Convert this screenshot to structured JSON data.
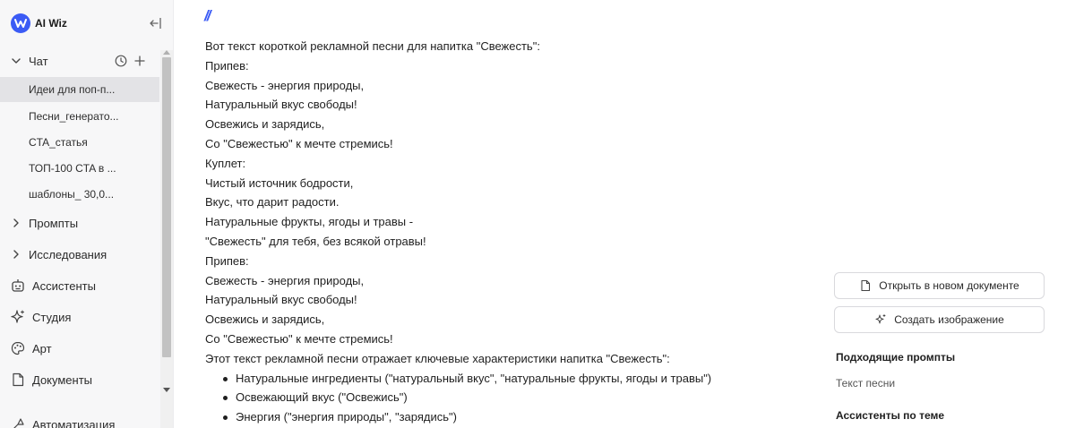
{
  "app": {
    "name": "AI Wiz",
    "accent_color": "#3b5bf5"
  },
  "sidebar": {
    "chat_section": {
      "label": "Чат"
    },
    "chats": [
      {
        "label": "Идеи для поп-п..."
      },
      {
        "label": "Песни_генерато..."
      },
      {
        "label": "CTA_статья"
      },
      {
        "label": "ТОП-100 CTA в ..."
      },
      {
        "label": "шаблоны_ 30,0..."
      }
    ],
    "collapsed_sections": [
      {
        "label": "Промпты"
      },
      {
        "label": "Исследования"
      }
    ],
    "nav": [
      {
        "label": "Ассистенты",
        "icon": "robot-icon"
      },
      {
        "label": "Студия",
        "icon": "sparkle-icon"
      },
      {
        "label": "Арт",
        "icon": "palette-icon"
      },
      {
        "label": "Документы",
        "icon": "document-icon"
      },
      {
        "label": "Автоматизация",
        "icon": "automation-icon"
      }
    ]
  },
  "message": {
    "lines": [
      "Вот текст короткой рекламной песни для напитка \"Свежесть\":",
      "Припев:",
      "Свежесть - энергия природы,",
      "Натуральный вкус свободы!",
      "Освежись и зарядись,",
      "Со \"Свежестью\" к мечте стремись!",
      "Куплет:",
      "Чистый источник бодрости,",
      "Вкус, что дарит радости.",
      "Натуральные фрукты, ягоды и травы -",
      "\"Свежесть\" для тебя, без всякой отравы!",
      "Припев:",
      "Свежесть - энергия природы,",
      "Натуральный вкус свободы!",
      "Освежись и зарядись,",
      "Со \"Свежестью\" к мечте стремись!",
      "Этот текст рекламной песни отражает ключевые характеристики напитка \"Свежесть\":"
    ],
    "bullets": [
      "Натуральные ингредиенты (\"натуральный вкус\", \"натуральные фрукты, ягоды и травы\")",
      "Освежающий вкус (\"Освежись\")",
      "Энергия (\"энергия природы\", \"зарядись\")"
    ]
  },
  "right_panel": {
    "open_doc_button": "Открыть в новом документе",
    "create_image_button": "Создать изображение",
    "prompts_heading": "Подходящие промпты",
    "prompt_item": "Текст песни",
    "assistants_heading": "Ассистенты по теме"
  }
}
